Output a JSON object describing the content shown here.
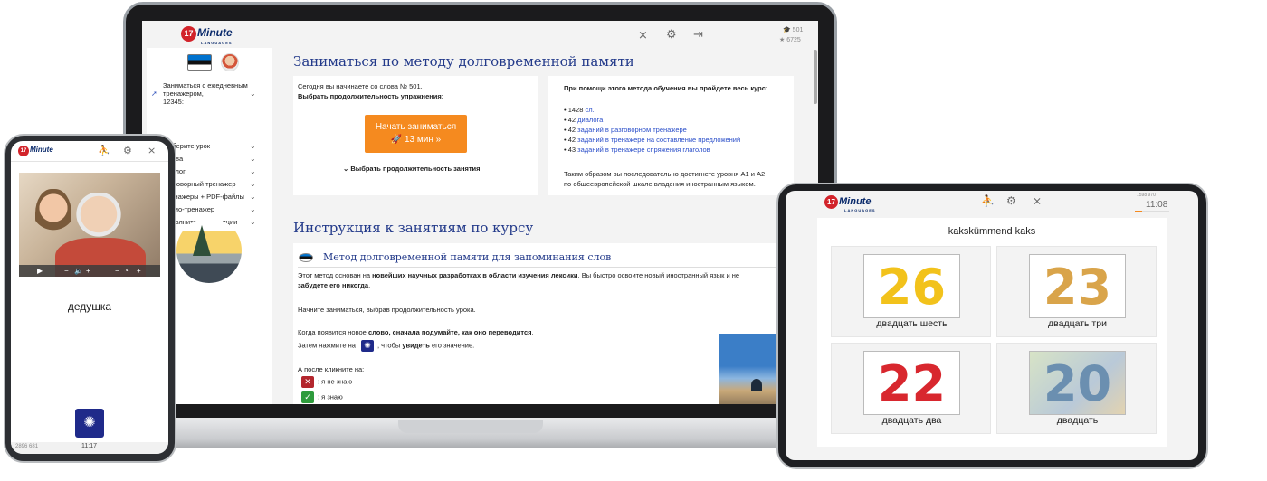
{
  "laptop": {
    "brand": {
      "badge": "17",
      "name": "Minute",
      "tagline": "LANGUAGES"
    },
    "stats": {
      "words": "501",
      "points": "6725"
    },
    "sidebar": {
      "daily": "Заниматься с ежедневным тренажером,",
      "daily_count": "12345:",
      "items": [
        {
          "label": "Выберите урок"
        },
        {
          "label": "Слова"
        },
        {
          "label": "Диалог"
        },
        {
          "label": "Разговорный тренажер"
        },
        {
          "label": "Тренажеры + PDF-файлы"
        },
        {
          "label": "Аудио-тренажер"
        },
        {
          "label": "Дополнительные опции"
        }
      ]
    },
    "main": {
      "title": "Заниматься по методу долговременной памяти",
      "today": "Сегодня вы начинаете со слова № 501.",
      "choose_duration": "Выбрать продолжительность упражнения:",
      "cta_label": "Начать заниматься",
      "cta_duration": "🚀 13 мин »",
      "duration_toggle": "⌄ Выбрать продолжительность занятия",
      "course_heading": "При помощи этого метода обучения вы пройдете весь курс:",
      "course_items": [
        {
          "count": "• 1428",
          "link": "сл."
        },
        {
          "count": "• 42",
          "link": "диалога"
        },
        {
          "count": "• 42",
          "link": "заданий в разговорном тренажере"
        },
        {
          "count": "• 42",
          "link": "заданий в тренажере на составление предложений"
        },
        {
          "count": "• 43",
          "link": "заданий в тренажере спряжения глаголов"
        }
      ],
      "level_line1": "Таким образом вы последовательно достигнете уровня А1 и А2",
      "level_line2": "по общеевропейской шкале владения иностранным языком.",
      "instructions_title": "Инструкция к занятиям по курсу",
      "method_title": "Метод долговременной памяти для запоминания слов",
      "method_p1a": "Этот метод основан на ",
      "method_p1b": "новейших научных разработках в области изучения лексики",
      "method_p1c": ". Вы быстро освоите новый иностранный язык и не",
      "method_p1d": "забудете его никогда",
      "method_p1e": ".",
      "start_text": "Начните заниматься, выбрав продолжительность урока.",
      "when_a": "Когда появится новое ",
      "when_b": "слово, сначала подумайте, как оно переводится",
      "when_c": ".",
      "then_a": "Затем нажмите на",
      "then_b": ", чтобы ",
      "then_c": "увидеть",
      "then_d": " его значение.",
      "after": "А после кликните на:",
      "dont_know": ": я не знаю",
      "know": ": я знаю"
    }
  },
  "phone": {
    "brand": {
      "badge": "17",
      "name": "Minute"
    },
    "word": "дедушка",
    "footer_stats": "2896  681",
    "time": "11:17"
  },
  "tablet": {
    "brand": {
      "badge": "17",
      "name": "Minute",
      "tagline": "LANGUAGES"
    },
    "stats": "1598  970",
    "time": "11:08",
    "word": "kakskümmend kaks",
    "tiles": [
      {
        "num": "26",
        "caption": "двадцать шесть",
        "color": "#f2c21b"
      },
      {
        "num": "23",
        "caption": "двадцать три",
        "color": "#d9a44a"
      },
      {
        "num": "22",
        "caption": "двадцать два",
        "color": "#d8272e"
      },
      {
        "num": "20",
        "caption": "двадцать",
        "color": "#6b8fb0"
      }
    ]
  },
  "colors": {
    "accent": "#233a8a",
    "cta": "#f58a1f",
    "link": "#2a4ec9",
    "no": "#b3262d",
    "yes": "#2e9b3c"
  },
  "icons": [
    "running-icon",
    "gear-icon",
    "mute-icon",
    "logout-icon",
    "graduation-cap-icon",
    "star-icon",
    "rocket-icon",
    "bulb-icon",
    "play-icon",
    "volume-icon"
  ]
}
